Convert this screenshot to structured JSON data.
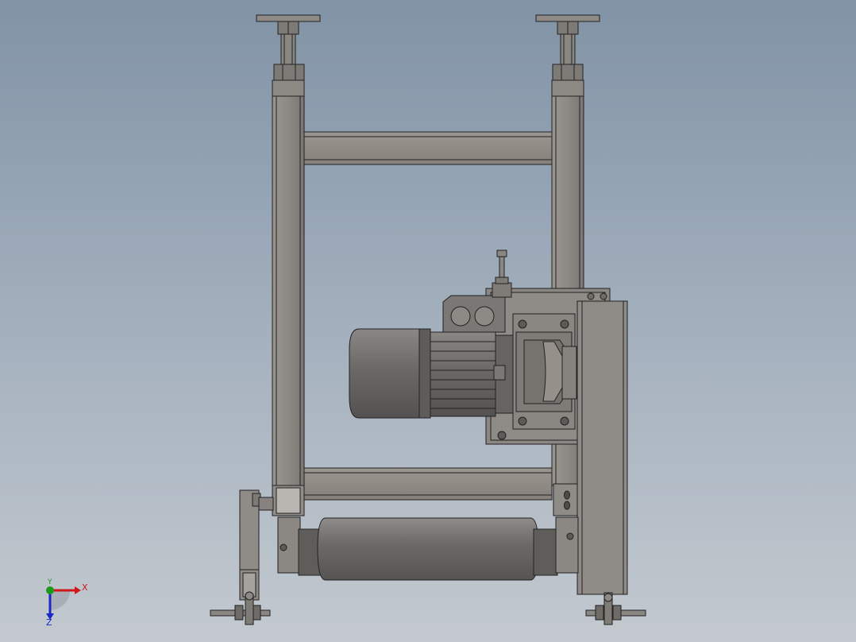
{
  "view": {
    "background_top": "#8193a6",
    "background_bottom": "#c3c9cf",
    "model_color": "#8f8b86",
    "motor_color": "#6e6c6a",
    "edge_color": "#222222"
  },
  "triad": {
    "x_label": "X",
    "y_label": "Y",
    "z_label": "Z",
    "x_color": "#d01818",
    "y_color": "#1a9a1a",
    "z_color": "#1a28c8"
  }
}
